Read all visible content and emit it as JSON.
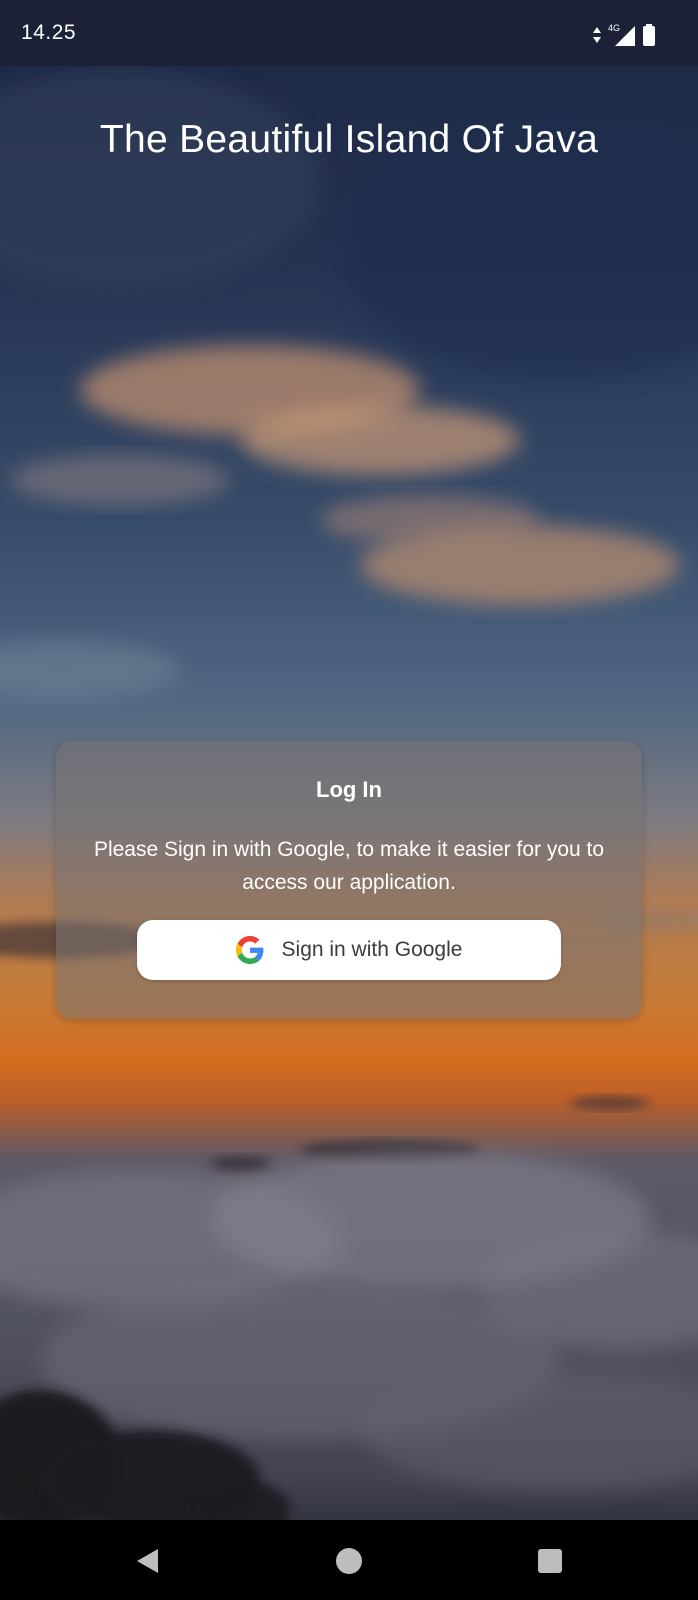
{
  "status_bar": {
    "time": "14.25",
    "network": "4G"
  },
  "app": {
    "title": "The Beautiful Island Of Java"
  },
  "login_card": {
    "title": "Log In",
    "description": "Please Sign in with Google, to make it easier for you to access our application.",
    "google_button_label": "Sign in with Google"
  },
  "icons": {
    "status": [
      "data-arrows-icon",
      "signal-4g-icon",
      "battery-icon"
    ],
    "button": "google-logo-icon",
    "navigation": [
      "back-icon",
      "home-icon",
      "recents-icon"
    ]
  },
  "colors": {
    "google_blue": "#4285F4",
    "google_red": "#EA4335",
    "google_yellow": "#FBBC05",
    "google_green": "#34A853",
    "button_background": "#ffffff",
    "card_background": "rgba(120,115,115,0.55)"
  }
}
